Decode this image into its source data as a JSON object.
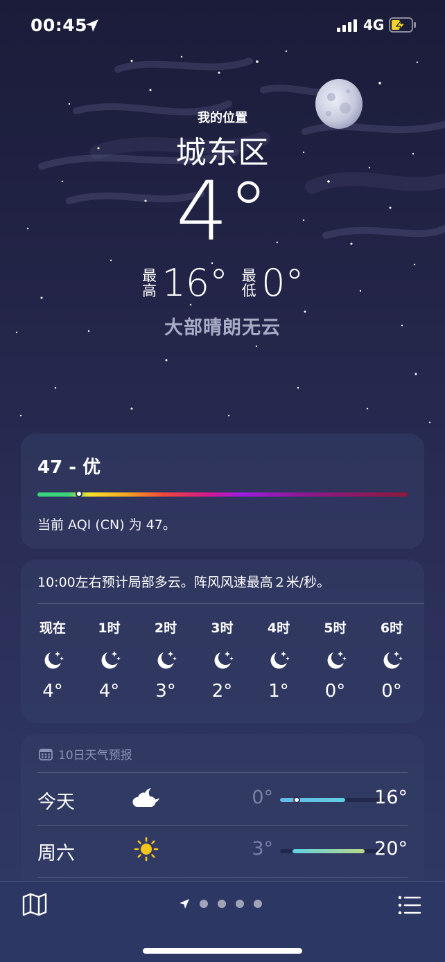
{
  "status_bar": {
    "time": "00:45",
    "network": "4G",
    "battery_state": "charging",
    "location_icon": "location-arrow-icon"
  },
  "header": {
    "my_location": "我的位置",
    "city": "城东区",
    "temperature": "4°",
    "high_label": "最高",
    "high_value": "16°",
    "low_label": "最低",
    "low_value": "0°",
    "condition": "大部晴朗无云"
  },
  "aqi": {
    "title": "47 - 优",
    "description": "当前 AQI (CN) 为 47。",
    "value": 47,
    "scale_max": 500
  },
  "hourly": {
    "summary": "10:00左右预计局部多云。阵风风速最高２米/秒。",
    "hours": [
      {
        "label": "现在",
        "icon": "moon-stars-icon",
        "temp": "4°"
      },
      {
        "label": "1时",
        "icon": "moon-stars-icon",
        "temp": "4°"
      },
      {
        "label": "2时",
        "icon": "moon-stars-icon",
        "temp": "3°"
      },
      {
        "label": "3时",
        "icon": "moon-stars-icon",
        "temp": "2°"
      },
      {
        "label": "4时",
        "icon": "moon-stars-icon",
        "temp": "1°"
      },
      {
        "label": "5时",
        "icon": "moon-stars-icon",
        "temp": "0°"
      },
      {
        "label": "6时",
        "icon": "moon-stars-icon",
        "temp": "0°"
      }
    ]
  },
  "daily": {
    "header": "10日天气预报",
    "header_icon": "calendar-icon",
    "days": [
      {
        "name": "今天",
        "icon": "cloud-moon-icon",
        "low": "0°",
        "high": "16°"
      },
      {
        "name": "周六",
        "icon": "sun-icon",
        "low": "3°",
        "high": "20°"
      }
    ]
  },
  "toolbar": {
    "map_icon": "map-icon",
    "list_icon": "list-icon",
    "page_count": 4,
    "current_page": "location"
  },
  "colors": {
    "background": "#24264a",
    "card": "#343e66",
    "condition_text": "#a9acc6",
    "muted_text": "#7b81a6",
    "sun": "#f6c71b"
  }
}
